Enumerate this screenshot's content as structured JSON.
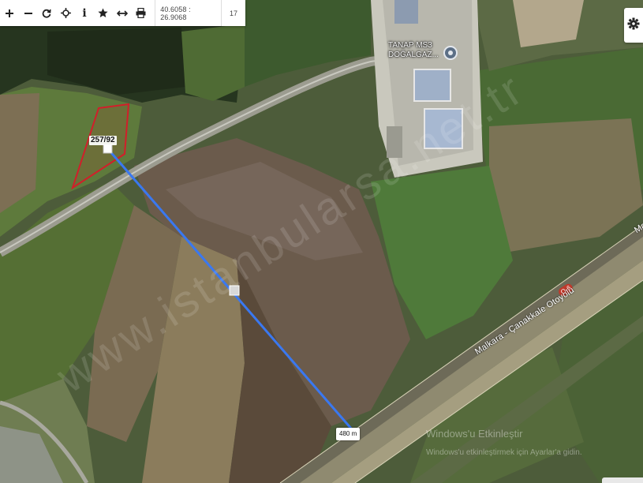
{
  "toolbar": {
    "buttons": [
      {
        "name": "zoom-in",
        "glyph": "+"
      },
      {
        "name": "zoom-out",
        "glyph": "−"
      },
      {
        "name": "refresh",
        "glyph": "⟳"
      },
      {
        "name": "locate",
        "glyph": "⌖"
      },
      {
        "name": "info",
        "glyph": "i"
      },
      {
        "name": "favorite",
        "glyph": "★"
      },
      {
        "name": "measure",
        "glyph": "↔"
      },
      {
        "name": "print",
        "glyph": "⎙"
      }
    ],
    "coordinates": "40.6058 : 26.9068",
    "zoom_level": "17"
  },
  "map": {
    "parcel_label": "257/92",
    "distance_label": "480 m",
    "facility_label": "TANAP MS3 DOĞALGAZ...",
    "highway_label": "Malkara - Çanakkale Otoyolu",
    "road_badge": "O-6",
    "edge_label": "Ma",
    "watermark": "www.istanbularsa.net.tr"
  },
  "windows_notice": {
    "title": "Windows'u Etkinleştir",
    "subtitle": "Windows'u etkinleştirmek için Ayarlar'a gidin."
  },
  "colors": {
    "measure_line": "#3a78f0",
    "parcel_outline": "#d21e2a",
    "toolbar_bg": "#ffffff"
  }
}
